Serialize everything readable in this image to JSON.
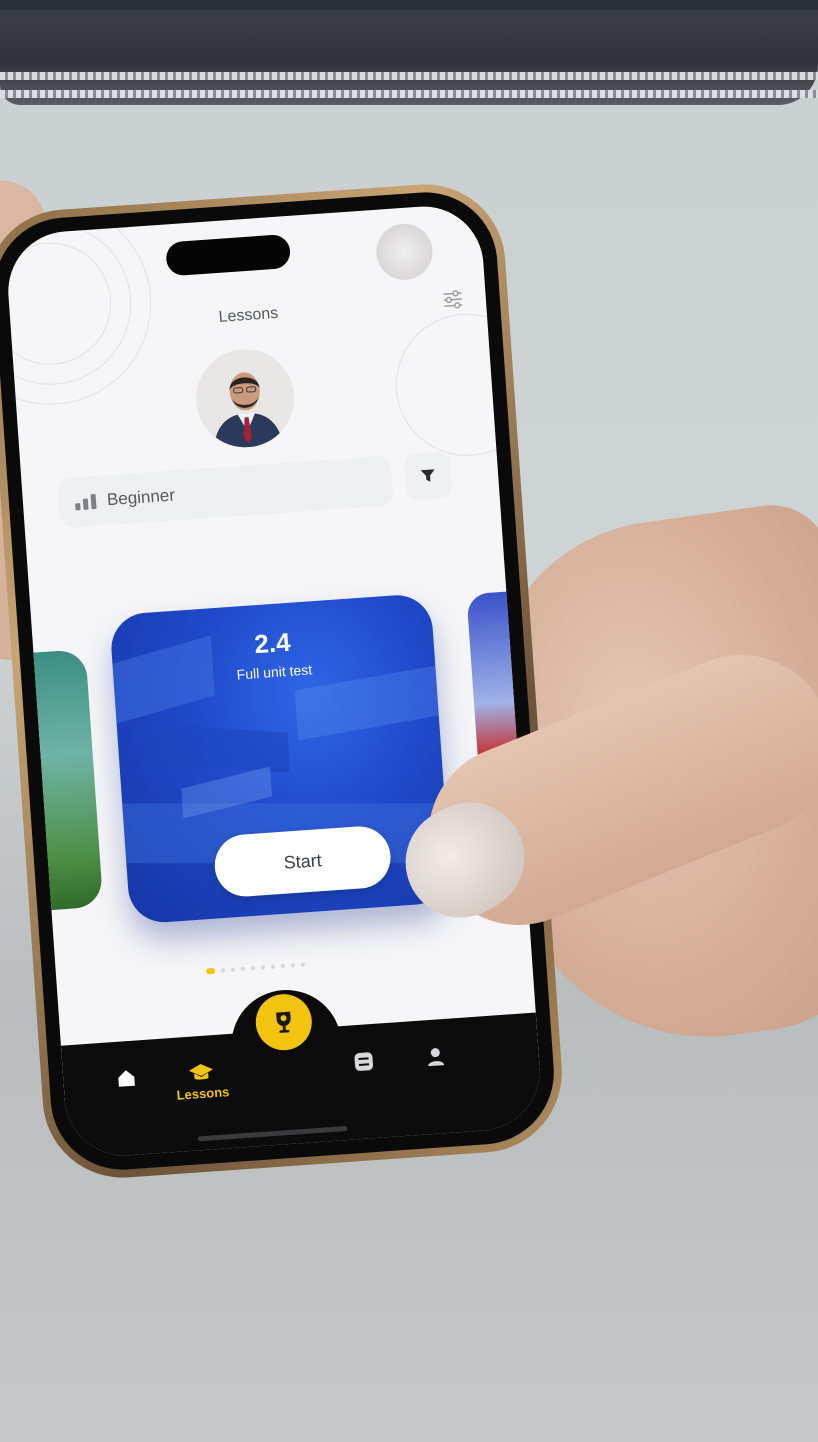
{
  "app": {
    "screen_title": "Lessons",
    "level_label": "Beginner"
  },
  "lesson_card": {
    "number": "2.4",
    "name": "Full unit test",
    "start_label": "Start"
  },
  "carousel": {
    "total_dots": 10,
    "active_index": 0
  },
  "tabbar": {
    "items": [
      {
        "icon": "home-icon",
        "label": ""
      },
      {
        "icon": "graduation-cap-icon",
        "label": "Lessons"
      },
      {
        "icon": "trophy-icon",
        "label": ""
      },
      {
        "icon": "checklist-icon",
        "label": ""
      },
      {
        "icon": "profile-icon",
        "label": ""
      }
    ],
    "active": "Lessons"
  },
  "colors": {
    "accent": "#f2c410",
    "card_blue": "#1f48c8",
    "tabbar_bg": "#0b0b0c"
  }
}
